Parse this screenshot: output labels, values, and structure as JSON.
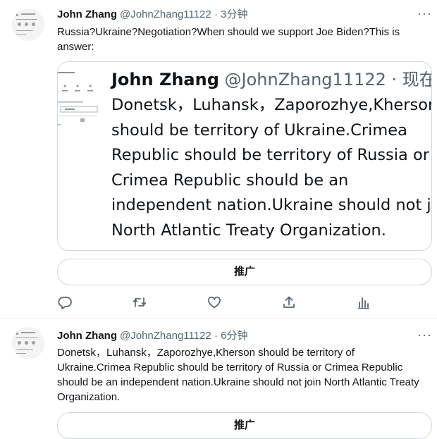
{
  "tweets": [
    {
      "author_name": "John Zhang",
      "handle": "@JohnZhang11122",
      "time": " · 3分钟",
      "more": "···",
      "text": "Russia?Ukraine?Negotiation?When should we support Joe Biden?This is answer:",
      "quoted": {
        "name": "John Zhang",
        "handle": "@JohnZhang11122",
        "time": " · 现在",
        "lines": [
          "Donetsk，Luhansk，Zaporozhye,Kherson",
          "should be territory of Ukraine.Crimea",
          "Republic should be territory of Russia or",
          "Crimea Republic should be an",
          "independent nation.Ukraine should not jo",
          "North Atlantic Treaty Organization."
        ]
      },
      "promote_label": "推广"
    },
    {
      "author_name": "John Zhang",
      "handle": "@JohnZhang11122",
      "time": " · 6分钟",
      "more": "···",
      "text": "Donetsk，Luhansk，Zaporozhye,Kherson should be territory of Ukraine.Crimea Republic should be territory of Russia or Crimea Republic should be an independent nation.Ukraine should not join North Atlantic Treaty Organization.",
      "promote_label": "推广"
    }
  ],
  "action_icons": [
    "reply-icon",
    "retweet-icon",
    "like-icon",
    "share-icon",
    "analytics-icon"
  ],
  "colors": {
    "text": "#0f1419",
    "secondary": "#536471",
    "border": "#cfd9de"
  }
}
